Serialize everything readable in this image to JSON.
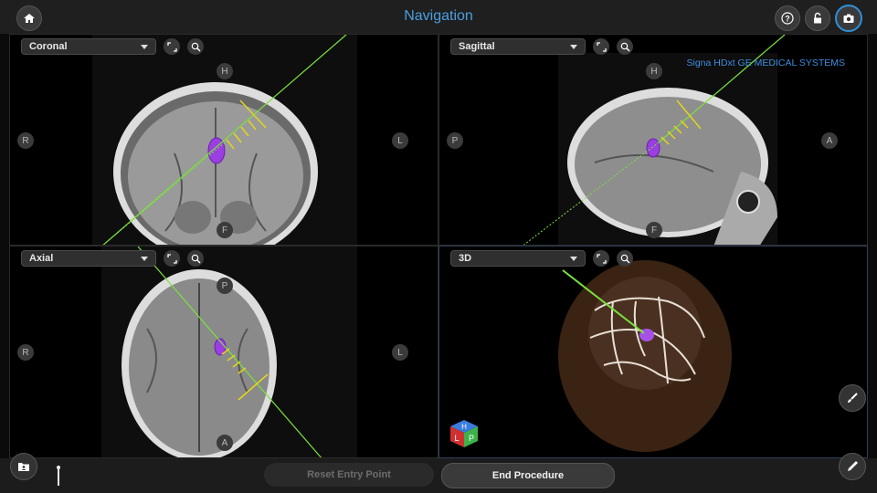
{
  "header": {
    "title": "Navigation"
  },
  "viewports": {
    "coronal": {
      "label": "Coronal",
      "orient": {
        "top": "H",
        "left": "R",
        "right": "L",
        "bottom": "F"
      }
    },
    "sagittal": {
      "label": "Sagittal",
      "orient": {
        "top": "H",
        "left": "P",
        "right": "A",
        "bottom": "F"
      },
      "overlay": "Signa HDxt GE MEDICAL SYSTEMS"
    },
    "axial": {
      "label": "Axial",
      "orient": {
        "top": "P",
        "left": "R",
        "right": "L",
        "bottom": "A"
      }
    },
    "three_d": {
      "label": "3D",
      "cube": {
        "a": "H",
        "b": "L",
        "c": "P"
      }
    }
  },
  "footer": {
    "reset_label": "Reset Entry Point",
    "end_label": "End Procedure"
  },
  "icons": [
    "home-icon",
    "help-icon",
    "lock-icon",
    "camera-icon",
    "chevron-down-icon",
    "expand-icon",
    "zoom-icon",
    "folder-icon",
    "probe-icon",
    "brush-icon",
    "pen-icon"
  ],
  "colors": {
    "accent": "#4a9fe0",
    "trajectory": "#7be23d",
    "target": "#9b3fe0",
    "marker": "#e4d61a"
  }
}
